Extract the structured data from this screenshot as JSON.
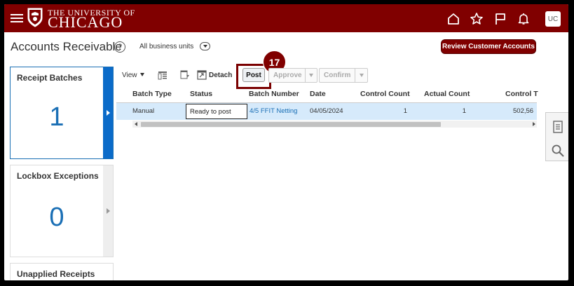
{
  "header": {
    "university_top": "THE UNIVERSITY OF",
    "university_main": "CHICAGO",
    "avatar_initials": "UC",
    "brand_color": "#800000"
  },
  "page": {
    "title": "Accounts Receivable",
    "business_unit": "All business units",
    "review_button": "Review Customer Accounts"
  },
  "tiles": [
    {
      "title": "Receipt Batches",
      "count": "1"
    },
    {
      "title": "Lockbox Exceptions",
      "count": "0"
    },
    {
      "title": "Unapplied Receipts"
    }
  ],
  "toolbar": {
    "view": "View",
    "detach": "Detach",
    "post": "Post",
    "approve": "Approve",
    "confirm": "Confirm",
    "step_badge": "17"
  },
  "table": {
    "columns": [
      "Batch Type",
      "Status",
      "Batch Number",
      "Date",
      "Control Count",
      "Actual Count",
      "Control T"
    ],
    "rows": [
      {
        "batch_type": "Manual",
        "status": "Ready to post",
        "batch_number": "4/5 FFIT Netting",
        "date": "04/05/2024",
        "control_count": "1",
        "actual_count": "1",
        "control_total": "502,56"
      }
    ]
  }
}
